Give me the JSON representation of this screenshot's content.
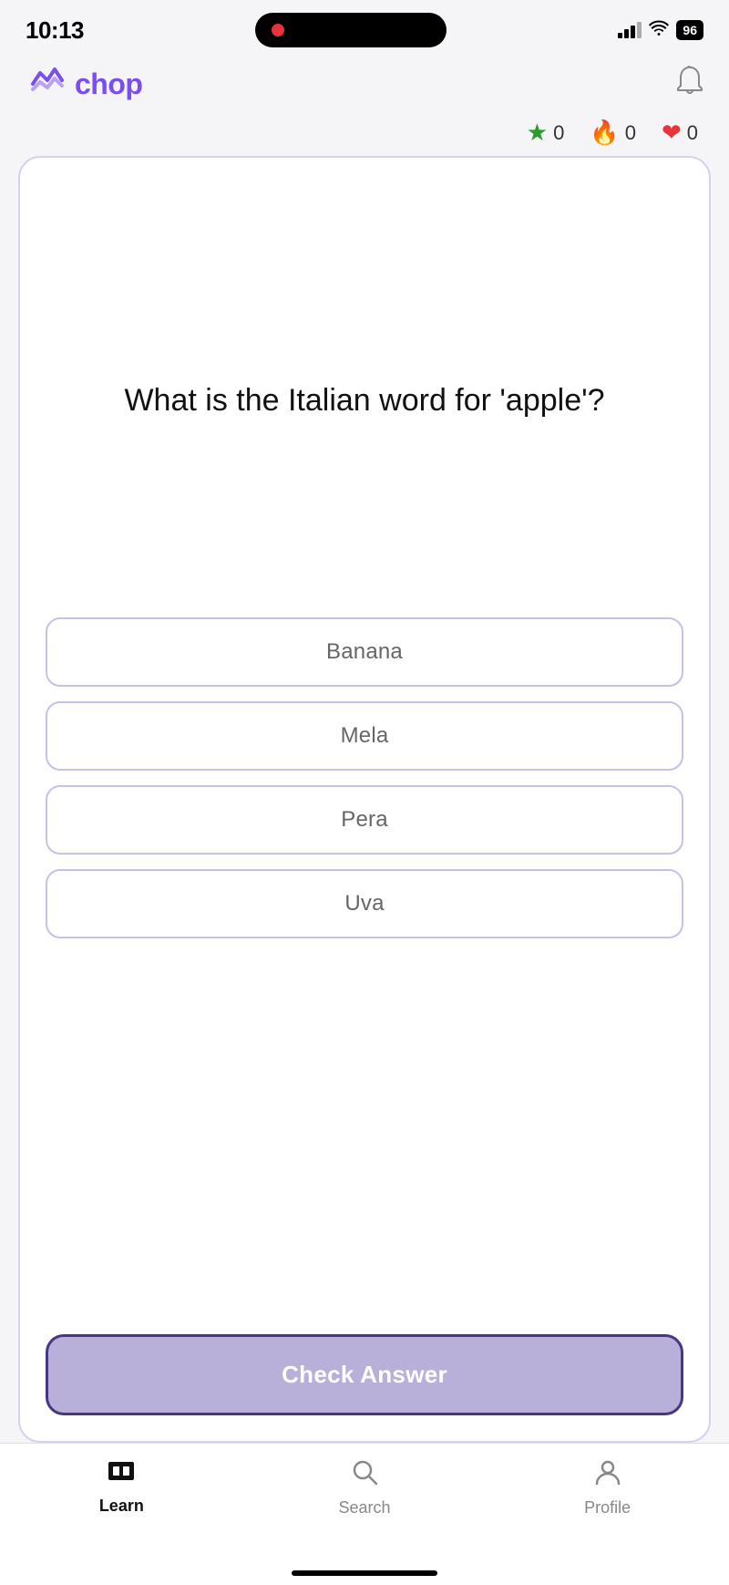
{
  "statusBar": {
    "time": "10:13",
    "battery": "96"
  },
  "header": {
    "logoText": "chop",
    "notificationIcon": "🔔"
  },
  "stats": {
    "starCount": "0",
    "flameCount": "0",
    "heartCount": "0",
    "starColor": "#2a9d2a",
    "flameColor": "#f5820a",
    "heartColor": "#e8323c"
  },
  "quiz": {
    "question": "What is the Italian word for 'apple'?",
    "options": [
      {
        "id": "opt1",
        "label": "Banana"
      },
      {
        "id": "opt2",
        "label": "Mela"
      },
      {
        "id": "opt3",
        "label": "Pera"
      },
      {
        "id": "opt4",
        "label": "Uva"
      }
    ],
    "checkAnswerLabel": "Check Answer"
  },
  "bottomNav": {
    "items": [
      {
        "id": "learn",
        "label": "Learn",
        "active": true
      },
      {
        "id": "search",
        "label": "Search",
        "active": false
      },
      {
        "id": "profile",
        "label": "Profile",
        "active": false
      }
    ]
  }
}
